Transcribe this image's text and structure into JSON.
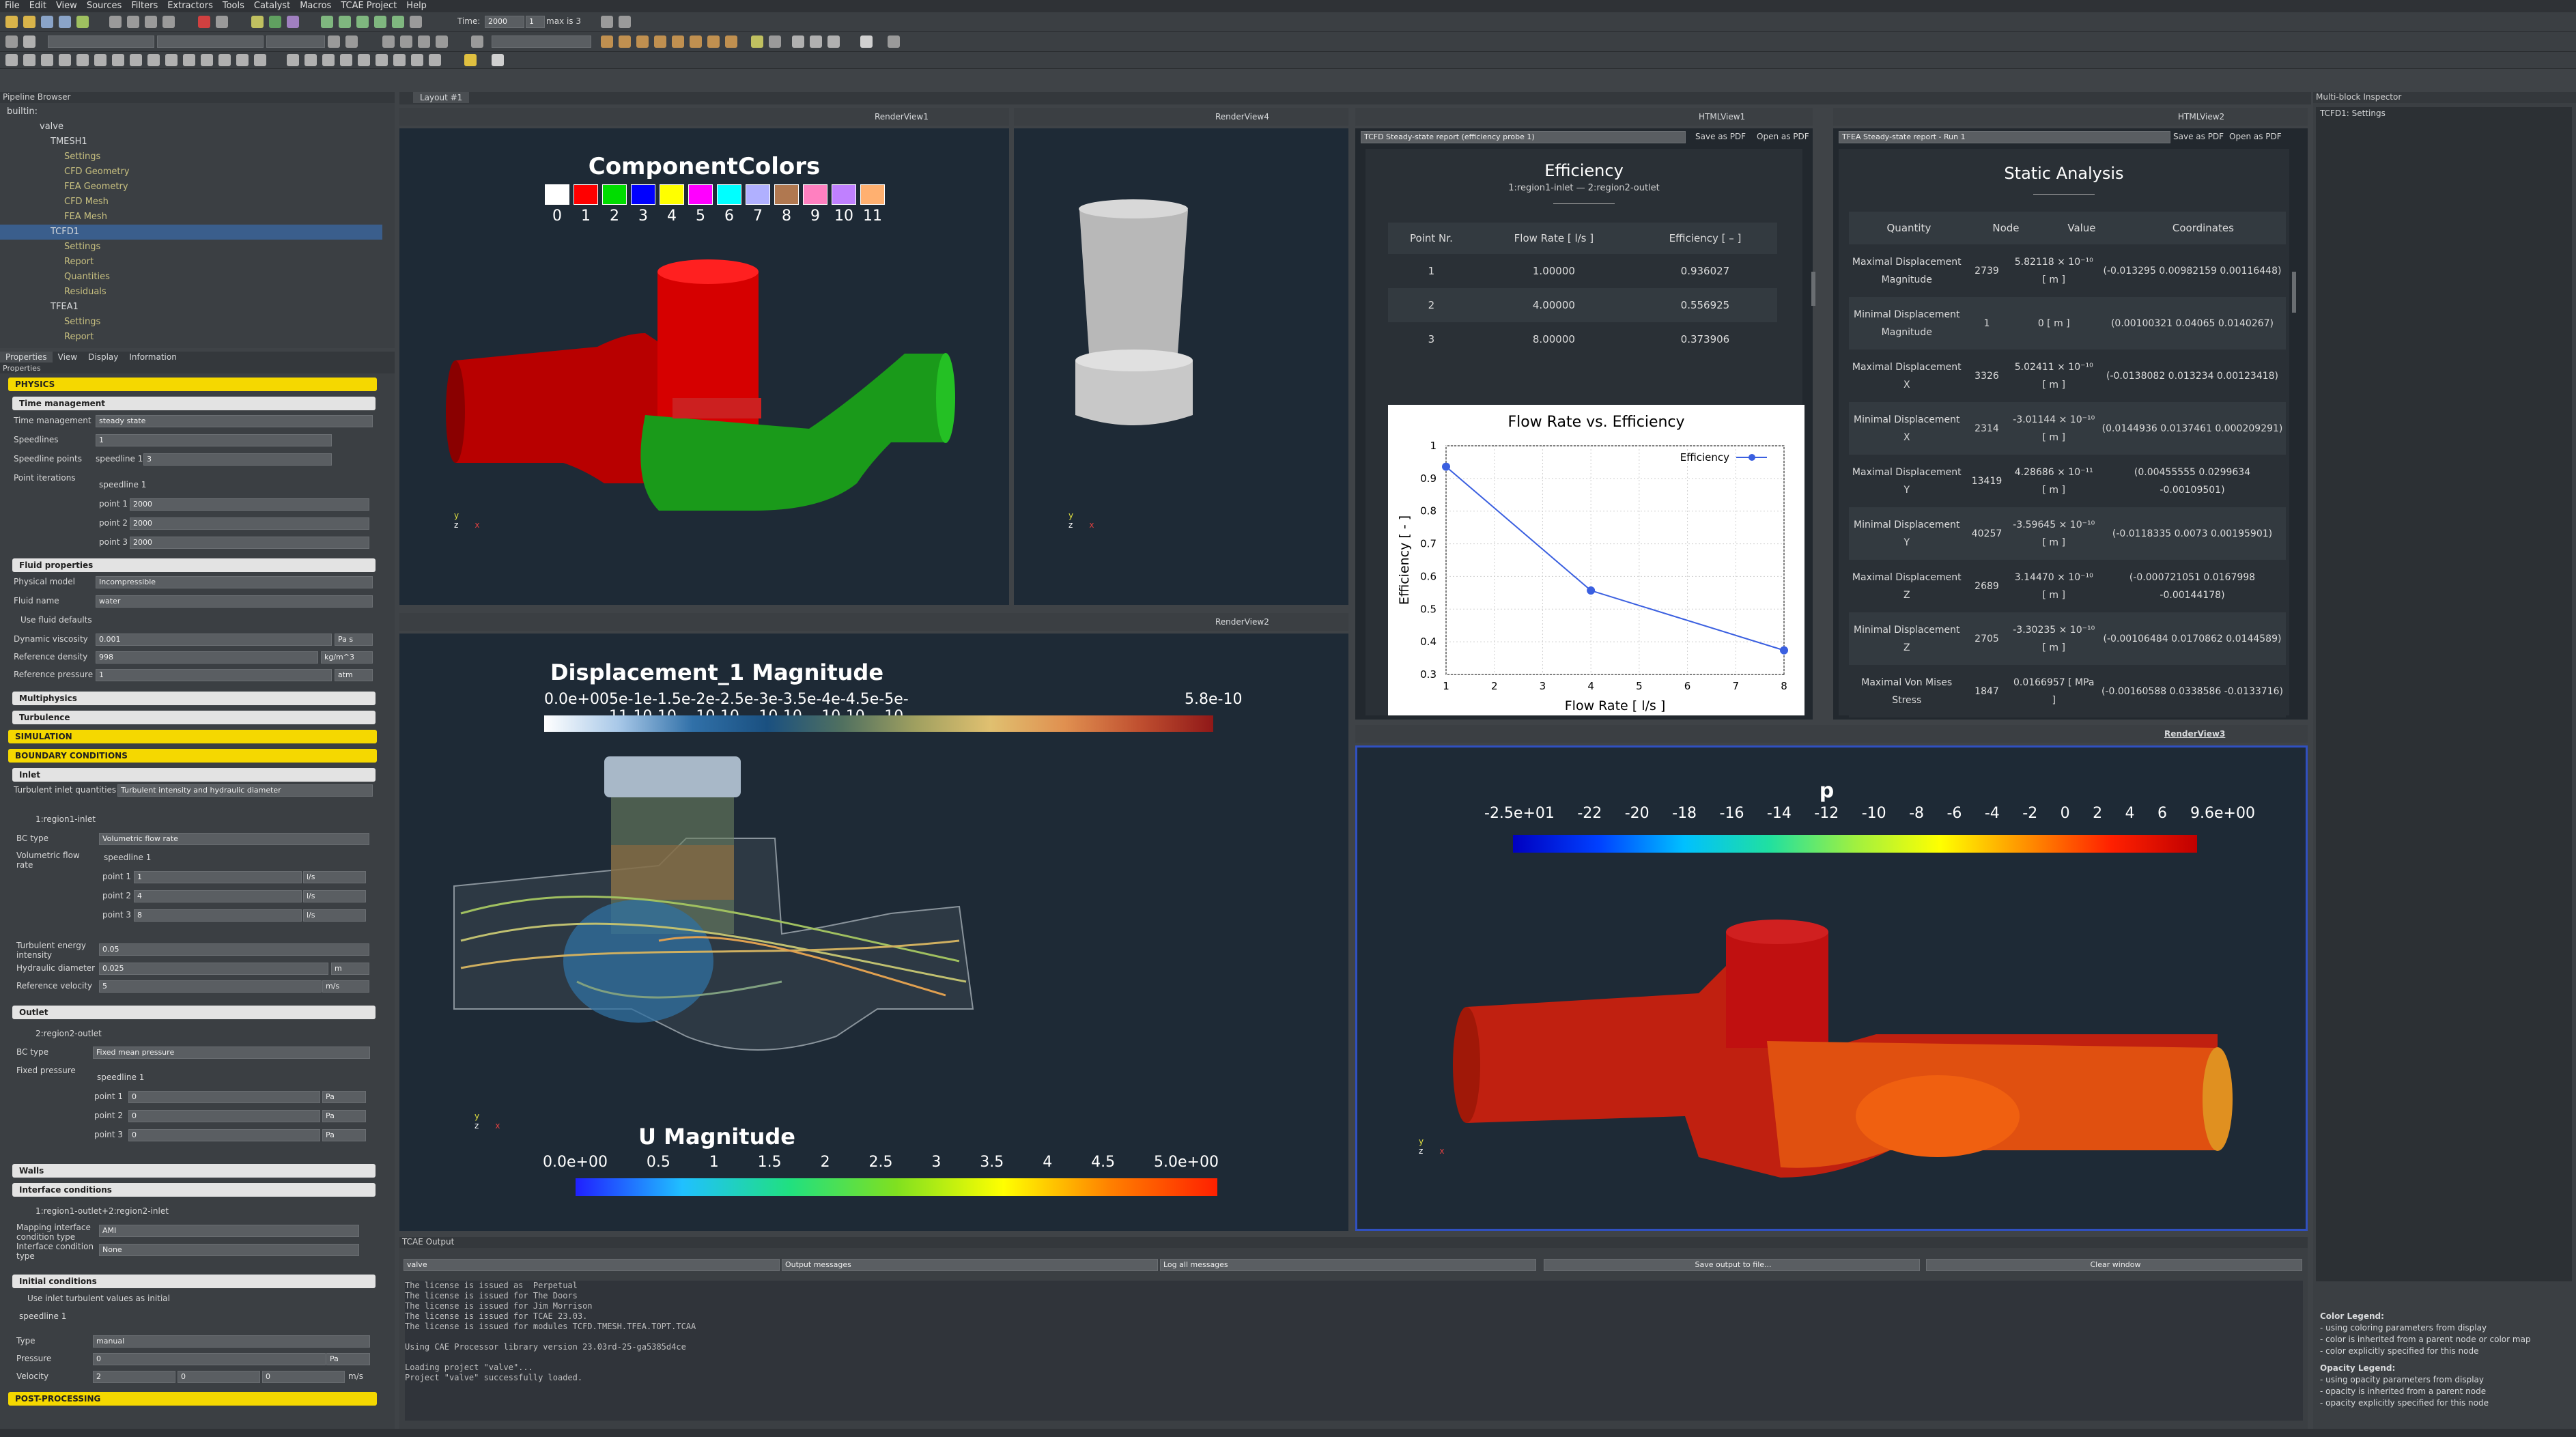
{
  "menu": [
    "File",
    "Edit",
    "View",
    "Sources",
    "Filters",
    "Extractors",
    "Tools",
    "Catalyst",
    "Macros",
    "TCAE Project",
    "Help"
  ],
  "toolbar": {
    "time_label": "Time:",
    "time_value": "2000",
    "step_value": "1",
    "max_label": "max is 3"
  },
  "pipeline": {
    "title": "Pipeline Browser",
    "items": [
      "builtin:",
      "valve",
      "TMESH1",
      "Settings",
      "CFD Geometry",
      "FEA Geometry",
      "CFD Mesh",
      "FEA Mesh",
      "TCFD1",
      "Settings",
      "Report",
      "Quantities",
      "Residuals",
      "TFEA1",
      "Settings",
      "Report"
    ]
  },
  "tabs": [
    "Properties",
    "View",
    "Display",
    "Information"
  ],
  "props": {
    "title": "Properties",
    "physics": "PHYSICS",
    "time_mgmt": "Time management",
    "time_mgmt_label": "Time management",
    "time_mgmt_value": "steady state",
    "speedlines": "Speedlines",
    "speedlines_value": "1",
    "speedline_points": "Speedline points",
    "speedline_points_sub": "speedline 1",
    "speedline_points_value": "3",
    "point_iterations": "Point iterations",
    "speedline_1": "speedline 1",
    "point1": "point 1",
    "point2": "point 2",
    "point3": "point 3",
    "iter_value": "2000",
    "fluid_props": "Fluid properties",
    "physical_model": "Physical model",
    "physical_model_value": "Incompressible",
    "fluid_name": "Fluid name",
    "fluid_name_value": "water",
    "use_defaults": "Use fluid defaults",
    "dyn_visc": "Dynamic viscosity",
    "dyn_visc_value": "0.001",
    "dyn_visc_unit": "Pa s",
    "ref_density": "Reference density",
    "ref_density_value": "998",
    "ref_density_unit": "kg/m^3",
    "ref_pressure": "Reference pressure",
    "ref_pressure_value": "1",
    "ref_pressure_unit": "atm",
    "multiphysics": "Multiphysics",
    "turbulence": "Turbulence",
    "simulation": "SIMULATION",
    "boundary": "BOUNDARY CONDITIONS",
    "inlet": "Inlet",
    "turb_inlet": "Turbulent inlet quantities",
    "turb_inlet_value": "Turbulent intensity and hydraulic diameter",
    "inlet_name": "1:region1-inlet",
    "bc_type": "BC type",
    "bc_type_inlet": "Volumetric flow rate",
    "vol_flow": "Volumetric flow rate",
    "flow1": "1",
    "flow2": "4",
    "flow3": "8",
    "flow_unit": "l/s",
    "turb_energy": "Turbulent energy intensity",
    "turb_energy_value": "0.05",
    "hyd_diam": "Hydraulic diameter",
    "hyd_diam_value": "0.025",
    "hyd_diam_unit": "m",
    "ref_vel": "Reference velocity",
    "ref_vel_value": "5",
    "ref_vel_unit": "m/s",
    "outlet": "Outlet",
    "outlet_name": "2:region2-outlet",
    "bc_type_outlet": "Fixed mean pressure",
    "fixed_pressure": "Fixed pressure",
    "p_value": "0",
    "p_unit": "Pa",
    "walls": "Walls",
    "interface": "Interface conditions",
    "interface_name": "1:region1-outlet+2:region2-inlet",
    "mapping": "Mapping interface condition type",
    "mapping_value": "AMI",
    "interface_type": "Interface condition type",
    "interface_type_value": "None",
    "initial": "Initial conditions",
    "use_inlet": "Use inlet turbulent values as initial",
    "type": "Type",
    "type_value": "manual",
    "pressure": "Pressure",
    "pressure_value": "0",
    "pressure_unit": "Pa",
    "velocity": "Velocity",
    "vel_x": "2",
    "vel_y": "0",
    "vel_z": "0",
    "vel_unit": "m/s",
    "post": "POST-PROCESSING"
  },
  "layout_tab": "Layout #1",
  "views": {
    "rv1": "RenderView1",
    "rv4": "RenderView4",
    "rv2": "RenderView2",
    "rv3": "RenderView3",
    "html1": "HTMLView1",
    "html2": "HTMLView2"
  },
  "component_colors": {
    "title": "ComponentColors",
    "labels": [
      "0",
      "1",
      "2",
      "3",
      "4",
      "5",
      "6",
      "7",
      "8",
      "9",
      "10",
      "11"
    ],
    "colors": [
      "#ffffff",
      "#ff0000",
      "#00dd00",
      "#0000ff",
      "#ffff00",
      "#ff00ff",
      "#00ffff",
      "#b0b0ff",
      "#b07850",
      "#ff80c0",
      "#c080ff",
      "#ffb070"
    ]
  },
  "displacement": {
    "title": "Displacement_1 Magnitude",
    "ticks": [
      "0.0e+00",
      "5e-11",
      "1e-10",
      "1.5e-10",
      "2e-10",
      "2.5e-10",
      "3e-10",
      "3.5e-10",
      "4e-10",
      "4.5e-10",
      "5e-10",
      "5.8e-10"
    ]
  },
  "umag": {
    "title": "U Magnitude",
    "ticks": [
      "0.0e+00",
      "0.5",
      "1",
      "1.5",
      "2",
      "2.5",
      "3",
      "3.5",
      "4",
      "4.5",
      "5.0e+00"
    ]
  },
  "pscale": {
    "title": "p",
    "ticks": [
      "-2.5e+01",
      "-22",
      "-20",
      "-18",
      "-16",
      "-14",
      "-12",
      "-10",
      "-8",
      "-6",
      "-4",
      "-2",
      "0",
      "2",
      "4",
      "6",
      "9.6e+00"
    ]
  },
  "efficiency": {
    "select": "TCFD Steady-state report (efficiency probe 1)",
    "save_pdf": "Save as PDF",
    "open_pdf": "Open as PDF",
    "title": "Efficiency",
    "subtitle": "1:region1-inlet — 2:region2-outlet",
    "headers": [
      "Point Nr.",
      "Flow Rate [ l/s ]",
      "Efficiency [ – ]"
    ],
    "rows": [
      [
        "1",
        "1.00000",
        "0.936027"
      ],
      [
        "2",
        "4.00000",
        "0.556925"
      ],
      [
        "3",
        "8.00000",
        "0.373906"
      ]
    ]
  },
  "chart_data": {
    "type": "line",
    "title": "Flow Rate  vs. Efficiency",
    "xlabel": "Flow Rate [ l/s ]",
    "ylabel": "Efficiency [ - ]",
    "x": [
      1,
      4,
      8
    ],
    "series": [
      {
        "name": "Efficiency",
        "values": [
          0.936027,
          0.556925,
          0.373906
        ]
      }
    ],
    "xlim": [
      1,
      8
    ],
    "ylim": [
      0.3,
      1
    ],
    "xticks": [
      "1",
      "2",
      "3",
      "4",
      "5",
      "6",
      "7",
      "8"
    ],
    "yticks": [
      "0.3",
      "0.4",
      "0.5",
      "0.6",
      "0.7",
      "0.8",
      "0.9",
      "1"
    ],
    "legend": "top-right",
    "grid": true,
    "color": "#3a5fe0"
  },
  "static": {
    "select": "TFEA Steady-state report - Run 1",
    "save_pdf": "Save as PDF",
    "open_pdf": "Open as PDF",
    "title": "Static Analysis",
    "headers": [
      "Quantity",
      "Node",
      "Value",
      "Coordinates"
    ],
    "rows": [
      [
        "Maximal Displacement Magnitude",
        "2739",
        "5.82118 × 10⁻¹⁰ [ m ]",
        "(-0.013295 0.00982159 0.00116448)"
      ],
      [
        "Minimal Displacement Magnitude",
        "1",
        "0 [ m ]",
        "(0.00100321 0.04065 0.0140267)"
      ],
      [
        "Maximal Displacement X",
        "3326",
        "5.02411 × 10⁻¹⁰ [ m ]",
        "(-0.0138082 0.013234 0.00123418)"
      ],
      [
        "Minimal Displacement X",
        "2314",
        "-3.01144 × 10⁻¹⁰ [ m ]",
        "(0.0144936 0.0137461 0.000209291)"
      ],
      [
        "Maximal Displacement Y",
        "13419",
        "4.28686 × 10⁻¹¹ [ m ]",
        "(0.00455555 0.0299634 -0.00109501)"
      ],
      [
        "Minimal Displacement Y",
        "40257",
        "-3.59645 × 10⁻¹⁰ [ m ]",
        "(-0.0118335 0.0073 0.00195901)"
      ],
      [
        "Maximal Displacement Z",
        "2689",
        "3.14470 × 10⁻¹⁰ [ m ]",
        "(-0.000721051 0.0167998 -0.00144178)"
      ],
      [
        "Minimal Displacement Z",
        "2705",
        "-3.30235 × 10⁻¹⁰ [ m ]",
        "(-0.00106484 0.0170862 0.0144589)"
      ],
      [
        "Maximal Von Mises Stress",
        "1847",
        "0.0166957 [ MPa ]",
        "(-0.00160588 0.0338586 -0.0133716)"
      ]
    ]
  },
  "output": {
    "title": "TCAE Output",
    "source": "valve",
    "kind": "Output messages",
    "level": "Log all messages",
    "save": "Save output to file...",
    "clear": "Clear window",
    "lines": [
      "The license is issued as  Perpetual",
      "The license is issued for The Doors",
      "The license is issued for Jim Morrison",
      "The license is issued for TCAE 23.03.",
      "The license is issued for modules TCFD.TMESH.TFEA.TOPT.TCAA",
      "",
      "Using CAE Processor library version 23.03rd-25-ga5385d4ce",
      "",
      "Loading project \"valve\"...",
      "Project \"valve\" successfully loaded."
    ]
  },
  "inspector": {
    "title": "Multi-block Inspector",
    "item": "TCFD1: Settings",
    "color_legend": "Color Legend:",
    "color_items": [
      "- using coloring parameters from display",
      "- color is inherited from a parent node or color map",
      "- color explicitly specified for this node"
    ],
    "opacity_legend": "Opacity Legend:",
    "opacity_items": [
      "- using opacity parameters from display",
      "- opacity is inherited from a parent node",
      "- opacity explicitly specified for this node"
    ]
  }
}
